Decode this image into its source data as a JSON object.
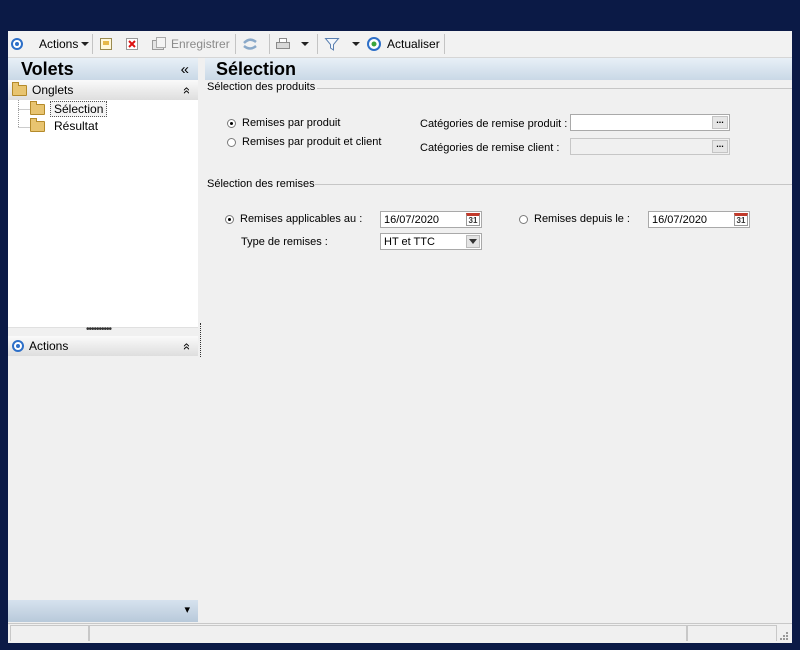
{
  "toolbar": {
    "actions_label": "Actions",
    "save_label": "Enregistrer",
    "refresh_label": "Actualiser"
  },
  "left_pane": {
    "title": "Volets",
    "collapse_glyph": "«",
    "tabs_section": {
      "label": "Onglets",
      "toggle_glyph": "»",
      "items": [
        {
          "label": "Sélection",
          "selected": true
        },
        {
          "label": "Résultat",
          "selected": false
        }
      ]
    },
    "actions_section": {
      "label": "Actions",
      "toggle_glyph": "»"
    },
    "bottom_bar_glyph": "▾"
  },
  "main": {
    "title": "Sélection",
    "products_group": {
      "title": "Sélection des produits",
      "radio_by_product": {
        "label": "Remises par produit",
        "checked": true
      },
      "radio_by_product_client": {
        "label": "Remises par produit et client",
        "checked": false
      },
      "product_category_label": "Catégories de remise produit :",
      "product_category_value": "",
      "client_category_label": "Catégories de remise client :",
      "client_category_value": "",
      "browse_glyph": "..."
    },
    "discounts_group": {
      "title": "Sélection des remises",
      "radio_applicable": {
        "label": "Remises applicables au :",
        "checked": true
      },
      "applicable_date": "16/07/2020",
      "radio_since": {
        "label": "Remises depuis le :",
        "checked": false
      },
      "since_date": "16/07/2020",
      "type_label": "Type de remises :",
      "type_value": "HT et TTC",
      "calendar_glyph": "31"
    }
  },
  "colors": {
    "background": "#0b1a46",
    "header_gradient_top": "#e8f0f7",
    "header_gradient_bottom": "#c9d8e6",
    "accent": "#2d6fc8"
  }
}
